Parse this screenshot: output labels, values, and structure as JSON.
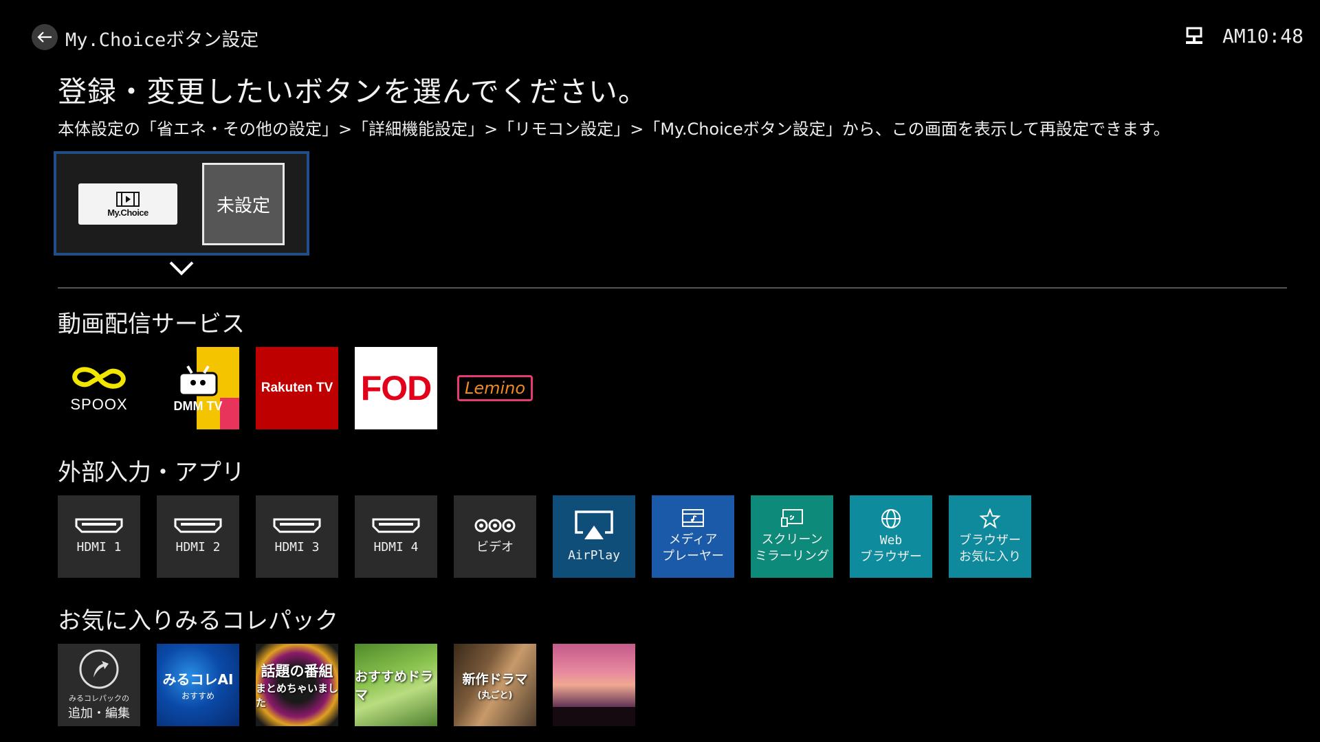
{
  "header": {
    "title": "My.Choiceボタン設定",
    "clock": "AM10:48",
    "back_icon": "back-arrow-icon",
    "network_icon": "network-icon"
  },
  "main_title": "登録・変更したいボタンを選んでください。",
  "subtitle": "本体設定の「省エネ・その他の設定」>「詳細機能設定」>「リモコン設定」>「My.Choiceボタン設定」から、この画面を表示して再設定できます。",
  "selection": {
    "button_label": "My.Choice",
    "unset_label": "未設定"
  },
  "sections": {
    "streaming": {
      "title": "動画配信サービス",
      "items": [
        {
          "name": "SPOOX",
          "label": "SPOOX"
        },
        {
          "name": "DMM TV",
          "label": "DMM TV"
        },
        {
          "name": "Rakuten TV",
          "label": "Rakuten TV"
        },
        {
          "name": "FOD",
          "label": "FOD"
        },
        {
          "name": "Lemino",
          "label": "Lemino"
        }
      ]
    },
    "inputs": {
      "title": "外部入力・アプリ",
      "items": [
        {
          "label": "HDMI 1",
          "icon": "hdmi-icon"
        },
        {
          "label": "HDMI 2",
          "icon": "hdmi-icon"
        },
        {
          "label": "HDMI 3",
          "icon": "hdmi-icon"
        },
        {
          "label": "HDMI 4",
          "icon": "hdmi-icon"
        },
        {
          "label": "ビデオ",
          "icon": "video-input-icon"
        },
        {
          "label": "AirPlay",
          "icon": "airplay-icon"
        },
        {
          "label_1": "メディア",
          "label_2": "プレーヤー",
          "icon": "media-player-icon"
        },
        {
          "label_1": "スクリーン",
          "label_2": "ミラーリング",
          "icon": "screen-mirroring-icon"
        },
        {
          "label_1": "Web",
          "label_2": "ブラウザー",
          "icon": "globe-icon"
        },
        {
          "label_1": "ブラウザー",
          "label_2": "お気に入り",
          "icon": "star-icon"
        }
      ]
    },
    "mirukore": {
      "title": "お気に入りみるコレパック",
      "items": [
        {
          "label_small": "みるコレパックの",
          "label": "追加・編集",
          "icon": "add-edit-icon"
        },
        {
          "label": "みるコレAI",
          "sub": "おすすめ"
        },
        {
          "label_1": "話題の番組",
          "label_2": "まとめちゃいました"
        },
        {
          "label": "おすすめドラマ"
        },
        {
          "label": "新作ドラマ",
          "sub": "(丸ごと)"
        },
        {
          "label": ""
        }
      ]
    }
  },
  "colors": {
    "selection_border": "#1f4f86",
    "airplay": "#0e4e79",
    "media_player": "#1b5aa9",
    "teal": "#0e8a7b",
    "spoox_yellow": "#f2e600",
    "rakuten_red": "#bf0000",
    "fod_red": "#e2001a"
  }
}
